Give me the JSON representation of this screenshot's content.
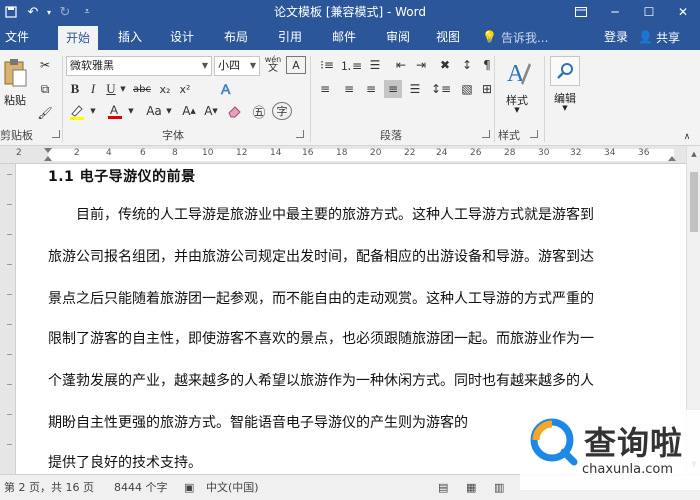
{
  "window": {
    "title": "论文模板 [兼容模式] - Word"
  },
  "tabs": [
    {
      "label": "文件",
      "active": false
    },
    {
      "label": "开始",
      "active": true
    },
    {
      "label": "插入",
      "active": false
    },
    {
      "label": "设计",
      "active": false
    },
    {
      "label": "布局",
      "active": false
    },
    {
      "label": "引用",
      "active": false
    },
    {
      "label": "邮件",
      "active": false
    },
    {
      "label": "审阅",
      "active": false
    },
    {
      "label": "视图",
      "active": false
    }
  ],
  "tellme": {
    "placeholder": "告诉我..."
  },
  "account": {
    "login": "登录",
    "share": "共享"
  },
  "ribbon": {
    "clipboard": {
      "paste": "粘贴",
      "group_label": "剪贴板"
    },
    "font": {
      "name": "微软雅黑",
      "size": "小四",
      "group_label": "字体",
      "phonetic": "wén",
      "bold": "B",
      "italic": "I",
      "underline": "U",
      "strike": "abc",
      "sub": "x₂",
      "sup": "x²",
      "color_a": "A",
      "aa": "Aa"
    },
    "paragraph": {
      "group_label": "段落"
    },
    "styles": {
      "label": "样式",
      "group_label": "样式"
    },
    "editing": {
      "label": "编辑"
    }
  },
  "ruler": {
    "numbers": [
      "2",
      "2",
      "4",
      "6",
      "8",
      "10",
      "12",
      "14",
      "16",
      "18",
      "20",
      "22",
      "24",
      "26",
      "28",
      "30",
      "32",
      "34",
      "36"
    ]
  },
  "document": {
    "heading": "1.1 电子导游仪的前景",
    "lines": [
      "　　目前，传统的人工导游是旅游业中最主要的旅游方式。这种人工导游方式就是游客到",
      "旅游公司报名组团，并由旅游公司规定出发时间，配备相应的出游设备和导游。游客到达",
      "景点之后只能随着旅游团一起参观，而不能自由的走动观赏。这种人工导游的方式严重的",
      "限制了游客的自主性，即使游客不喜欢的景点，也必须跟随旅游团一起。而旅游业作为一",
      "个蓬勃发展的产业，越来越多的人希望以旅游作为一种休闲方式。同时也有越来越多的人",
      "期盼自主性更强的旅游方式。智能语音电子导游仪的产生则为游客的",
      "提供了良好的技术支持。"
    ]
  },
  "status": {
    "page": "第 2 页，共 16 页",
    "words": "8444 个字",
    "language": "中文(中国)"
  },
  "watermark": {
    "cn": "查询啦",
    "en": "chaxunla.com"
  },
  "colors": {
    "brand": "#2b579a",
    "ribbon_bg": "#f3f3f3"
  }
}
